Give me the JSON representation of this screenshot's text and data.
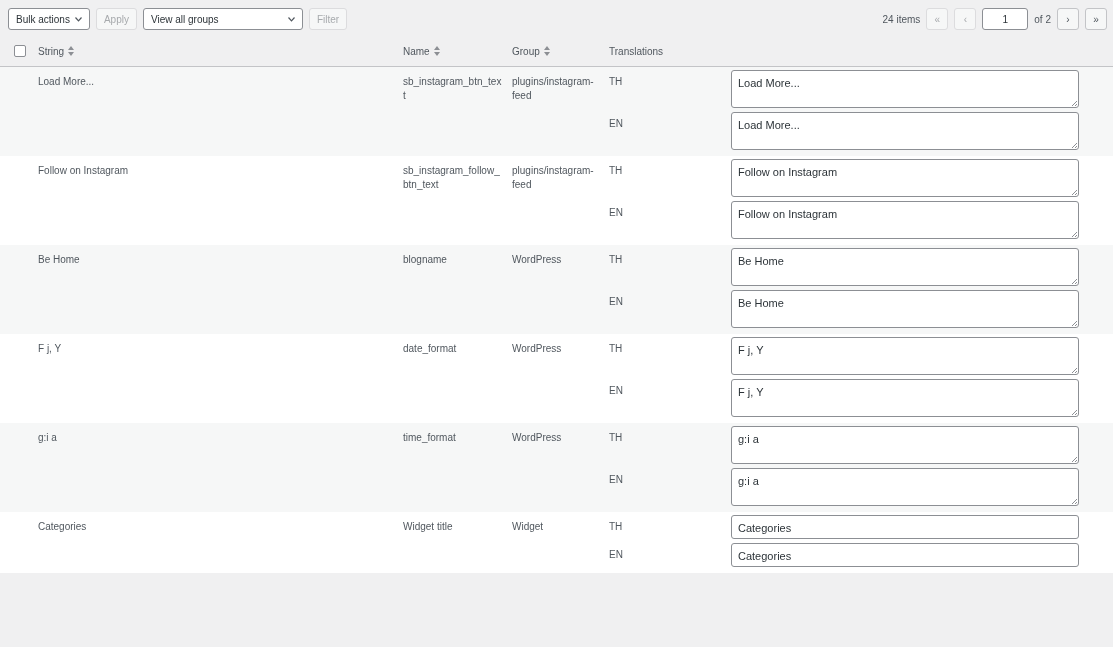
{
  "toolbar": {
    "bulk_actions": "Bulk actions",
    "apply": "Apply",
    "group_filter": "View all groups",
    "filter": "Filter"
  },
  "pagination": {
    "count": "24 items",
    "first": "«",
    "prev": "‹",
    "page": "1",
    "of": "of 2",
    "next": "›",
    "last": "»"
  },
  "table": {
    "select_all": {
      "checked": false
    },
    "columns": [
      "String",
      "Name",
      "Group",
      "Translations"
    ],
    "rows": [
      {
        "string": "Load More...",
        "name": "sb_instagram_btn_text",
        "group": "plugins/instagram-feed",
        "translations": [
          {
            "lang": "TH",
            "kind": "textarea",
            "value": "Load More..."
          },
          {
            "lang": "EN",
            "kind": "textarea",
            "value": "Load More..."
          }
        ]
      },
      {
        "string": "Follow on Instagram",
        "name": "sb_instagram_follow_btn_text",
        "group": "plugins/instagram-feed",
        "translations": [
          {
            "lang": "TH",
            "kind": "textarea",
            "value": "Follow on Instagram"
          },
          {
            "lang": "EN",
            "kind": "textarea",
            "value": "Follow on Instagram"
          }
        ]
      },
      {
        "string": "Be Home",
        "name": "blogname",
        "group": "WordPress",
        "translations": [
          {
            "lang": "TH",
            "kind": "textarea",
            "value": "Be Home"
          },
          {
            "lang": "EN",
            "kind": "textarea",
            "value": "Be Home"
          }
        ]
      },
      {
        "string": "F j, Y",
        "name": "date_format",
        "group": "WordPress",
        "translations": [
          {
            "lang": "TH",
            "kind": "textarea",
            "value": "F j, Y"
          },
          {
            "lang": "EN",
            "kind": "textarea",
            "value": "F j, Y"
          }
        ]
      },
      {
        "string": "g:i a",
        "name": "time_format",
        "group": "WordPress",
        "translations": [
          {
            "lang": "TH",
            "kind": "textarea",
            "value": "g:i a"
          },
          {
            "lang": "EN",
            "kind": "textarea",
            "value": "g:i a"
          }
        ]
      },
      {
        "string": "Categories",
        "name": "Widget title",
        "group": "Widget",
        "translations": [
          {
            "lang": "TH",
            "kind": "input",
            "value": "Categories"
          },
          {
            "lang": "EN",
            "kind": "input",
            "value": "Categories"
          }
        ]
      }
    ]
  }
}
